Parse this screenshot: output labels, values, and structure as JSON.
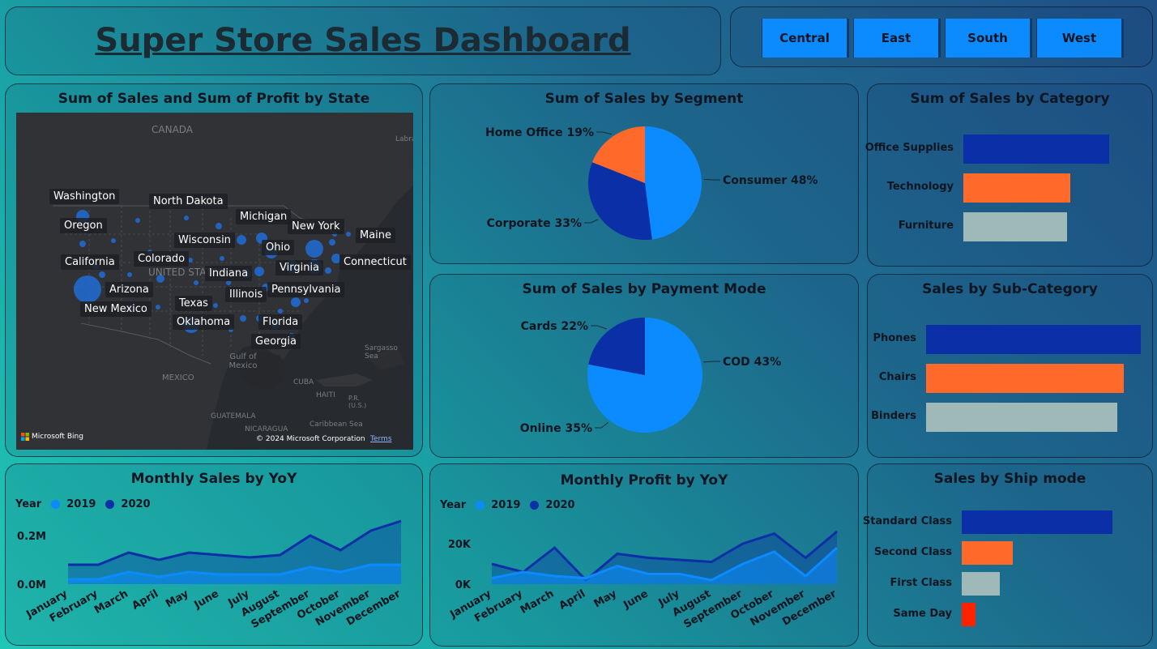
{
  "header": {
    "title": "Super Store Sales Dashboard"
  },
  "slicer": {
    "regions": [
      "Central",
      "East",
      "South",
      "West"
    ]
  },
  "colors": {
    "dark_blue": "#0a2fa6",
    "light_blue": "#0b8bff",
    "orange": "#ff6a2a",
    "grey": "#9fb8b8",
    "red": "#ff2200"
  },
  "map": {
    "title": "Sum of Sales and Sum of Profit by State",
    "country_labels": [
      "CANADA",
      "UNITED STATES",
      "MEXICO",
      "CUBA",
      "HAITI",
      "GUATEMALA",
      "NICARAGUA",
      "Gulf of Mexico",
      "Sargasso Sea",
      "Caribbean Sea",
      "Labrador",
      "P.R. (U.S.)"
    ],
    "state_labels": [
      "Washington",
      "North Dakota",
      "Oregon",
      "Michigan",
      "New York",
      "Maine",
      "Wisconsin",
      "Ohio",
      "California",
      "Colorado",
      "Connecticut",
      "Virginia",
      "Indiana",
      "Arizona",
      "Illinois",
      "Pennsylvania",
      "New Mexico",
      "Texas",
      "Oklahoma",
      "Florida",
      "Georgia"
    ],
    "attribution": "Microsoft Bing",
    "copyright": "© 2024 Microsoft Corporation",
    "terms": "Terms",
    "bubble_icon": "circle-marker"
  },
  "chart_data": [
    {
      "type": "pie",
      "title": "Sum of Sales by Segment",
      "categories": [
        "Consumer",
        "Corporate",
        "Home Office"
      ],
      "values": [
        48,
        33,
        19
      ],
      "labels": [
        "Consumer 48%",
        "Corporate 33%",
        "Home Office 19%"
      ],
      "colors": [
        "#0b8bff",
        "#0a2fa6",
        "#ff6a2a"
      ]
    },
    {
      "type": "pie",
      "title": "Sum of Sales by Payment Mode",
      "categories": [
        "COD",
        "Online",
        "Cards"
      ],
      "values": [
        43,
        35,
        22
      ],
      "labels": [
        "COD 43%",
        "Online 35%",
        "Cards 22%"
      ],
      "colors": [
        "#0b8bff",
        "#0b8bff",
        "#0a2fa6"
      ]
    },
    {
      "type": "bar",
      "orientation": "horizontal",
      "title": "Sum of Sales by Category",
      "categories": [
        "Office Supplies",
        "Technology",
        "Furniture"
      ],
      "values": [
        0.82,
        0.6,
        0.58
      ],
      "colors": [
        "#0a2fa6",
        "#ff6a2a",
        "#9fb8b8"
      ]
    },
    {
      "type": "bar",
      "orientation": "horizontal",
      "title": "Sales by Sub-Category",
      "categories": [
        "Phones",
        "Chairs",
        "Binders"
      ],
      "values": [
        1.0,
        0.92,
        0.89
      ],
      "colors": [
        "#0a2fa6",
        "#ff6a2a",
        "#9fb8b8"
      ]
    },
    {
      "type": "bar",
      "orientation": "horizontal",
      "title": "Sales by Ship mode",
      "categories": [
        "Standard Class",
        "Second Class",
        "First Class",
        "Same Day"
      ],
      "values": [
        1.0,
        0.34,
        0.25,
        0.09
      ],
      "colors": [
        "#0a2fa6",
        "#ff6a2a",
        "#9fb8b8",
        "#ff2200"
      ]
    },
    {
      "type": "area",
      "title": "Monthly Sales by YoY",
      "legend_title": "Year",
      "categories": [
        "January",
        "February",
        "March",
        "April",
        "May",
        "June",
        "July",
        "August",
        "September",
        "October",
        "November",
        "December"
      ],
      "series": [
        {
          "name": "2019",
          "values": [
            0.02,
            0.02,
            0.05,
            0.03,
            0.05,
            0.04,
            0.04,
            0.04,
            0.07,
            0.05,
            0.08,
            0.08
          ]
        },
        {
          "name": "2020",
          "values": [
            0.08,
            0.08,
            0.13,
            0.1,
            0.13,
            0.12,
            0.11,
            0.12,
            0.2,
            0.14,
            0.22,
            0.26
          ]
        }
      ],
      "yticks": [
        "0.0M",
        "0.2M"
      ],
      "ylim": [
        0,
        0.26
      ]
    },
    {
      "type": "area",
      "title": "Monthly Profit by YoY",
      "legend_title": "Year",
      "categories": [
        "January",
        "February",
        "March",
        "April",
        "May",
        "June",
        "July",
        "August",
        "September",
        "October",
        "November",
        "December"
      ],
      "series": [
        {
          "name": "2019",
          "values": [
            3000,
            6000,
            4000,
            3000,
            9000,
            5000,
            5000,
            2000,
            10000,
            16000,
            4000,
            18000
          ]
        },
        {
          "name": "2020",
          "values": [
            10000,
            6000,
            18000,
            2000,
            15000,
            13000,
            12000,
            11000,
            20000,
            25000,
            13000,
            26000
          ]
        }
      ],
      "yticks": [
        "0K",
        "20K"
      ],
      "ylim": [
        0,
        28000
      ]
    }
  ]
}
